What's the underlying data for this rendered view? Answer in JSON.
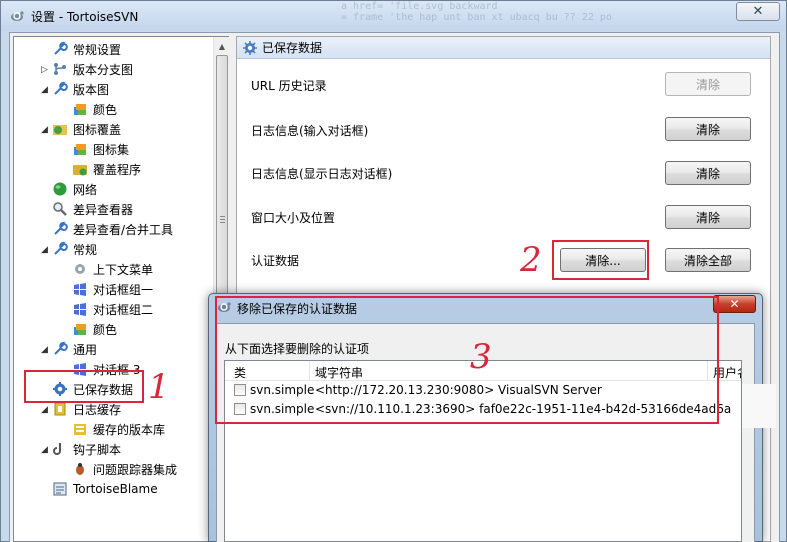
{
  "window": {
    "title": "设置 - TortoiseSVN",
    "close_glyph": "✕"
  },
  "background_code": {
    "line1": "a href= 'file.svg  backward",
    "line2": "= frame  'the hap unt ban xt ubacq bu ?? 22 po"
  },
  "tree": {
    "items": [
      {
        "label": "常规设置",
        "icon": "wrench-icon",
        "color": "#3a72c4"
      },
      {
        "label": "版本分支图",
        "icon": "branch-icon",
        "color": "#5a7fb0"
      },
      {
        "label": "版本图",
        "icon": "wrench-icon",
        "color": "#3a72c4"
      },
      {
        "label": "颜色",
        "icon": "palette-icon",
        "color": "#e8a023"
      },
      {
        "label": "图标覆盖",
        "icon": "overlay-icon",
        "color": "#43a047"
      },
      {
        "label": "图标集",
        "icon": "palette-icon",
        "color": "#e8a023"
      },
      {
        "label": "覆盖程序",
        "icon": "folder-overlay-icon",
        "color": "#d8b032"
      },
      {
        "label": "网络",
        "icon": "globe-icon",
        "color": "#2e9a3e"
      },
      {
        "label": "差异查看器",
        "icon": "magnifier-icon",
        "color": "#6a6a6a"
      },
      {
        "label": "差异查看/合并工具",
        "icon": "wrench-icon",
        "color": "#3a72c4"
      },
      {
        "label": "常规",
        "icon": "wrench-icon",
        "color": "#3a72c4"
      },
      {
        "label": "上下文菜单",
        "icon": "gear-icon",
        "color": "#9aa6b2"
      },
      {
        "label": "对话框组一",
        "icon": "windows-flag-icon",
        "color": "#4a6fd8"
      },
      {
        "label": "对话框组二",
        "icon": "windows-flag-icon",
        "color": "#4a6fd8"
      },
      {
        "label": "颜色",
        "icon": "palette-icon",
        "color": "#e8a023"
      },
      {
        "label": "通用",
        "icon": "wrench-icon",
        "color": "#3a72c4"
      },
      {
        "label": "对话框 3",
        "icon": "windows-flag-icon",
        "color": "#4a6fd8"
      },
      {
        "label": "已保存数据",
        "icon": "gear-blue-icon",
        "color": "#3a72c4"
      },
      {
        "label": "日志缓存",
        "icon": "cache-icon",
        "color": "#e5c130"
      },
      {
        "label": "缓存的版本库",
        "icon": "repo-icon",
        "color": "#e5c130"
      },
      {
        "label": "钩子脚本",
        "icon": "hook-icon",
        "color": "#555555"
      },
      {
        "label": "问题跟踪器集成",
        "icon": "bug-icon",
        "color": "#b85c2a"
      },
      {
        "label": "TortoiseBlame",
        "icon": "blame-icon",
        "color": "#4a6a8a"
      }
    ]
  },
  "panel": {
    "title": "已保存数据",
    "rows": [
      {
        "label": "URL 历史记录",
        "button": "清除",
        "disabled": true
      },
      {
        "label": "日志信息(输入对话框)",
        "button": "清除",
        "disabled": false
      },
      {
        "label": "日志信息(显示日志对话框)",
        "button": "清除",
        "disabled": false
      },
      {
        "label": "窗口大小及位置",
        "button": "清除",
        "disabled": false
      },
      {
        "label": "认证数据",
        "button": "清除...",
        "button2": "清除全部",
        "disabled": false
      }
    ]
  },
  "dialog": {
    "title": "移除已保存的认证数据",
    "close_glyph": "✕",
    "instruction": "从下面选择要删除的认证项",
    "columns": [
      "类",
      "域字符串",
      "用户名"
    ],
    "rows": [
      {
        "type": "svn.simple",
        "realm": "<http://172.20.13.230:9080> VisualSVN Server",
        "checked": false
      },
      {
        "type": "svn.simple",
        "realm": "<svn://10.110.1.23:3690> faf0e22c-1951-11e4-b42d-53166de4ad6a",
        "checked": false
      }
    ]
  },
  "annotations": {
    "one": "1",
    "two": "2",
    "three": "3",
    "color": "#d9263b"
  }
}
